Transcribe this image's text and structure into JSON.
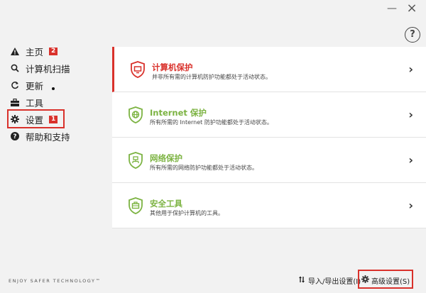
{
  "window": {
    "minimize_glyph": "—",
    "close_glyph": "×",
    "help_glyph": "?"
  },
  "sidebar": {
    "items": [
      {
        "label": "主页",
        "icon": "warning-icon",
        "badge": "2"
      },
      {
        "label": "计算机扫描",
        "icon": "search-icon"
      },
      {
        "label": "更新",
        "icon": "refresh-icon"
      },
      {
        "label": "工具",
        "icon": "toolbox-icon"
      },
      {
        "label": "设置",
        "icon": "gear-icon",
        "badge": "1",
        "highlighted": true
      },
      {
        "label": "帮助和支持",
        "icon": "help-icon"
      }
    ],
    "brand": "ENJOY SAFER TECHNOLOGY™"
  },
  "main": {
    "rows": [
      {
        "title": "计算机保护",
        "desc": "并非所有需的计算机防护功能都处于活动状态。",
        "status": "warning",
        "icon": "shield-monitor-icon"
      },
      {
        "title": "Internet 保护",
        "desc": "所有所需的 Internet 防护功能都处于活动状态。",
        "status": "ok",
        "icon": "shield-globe-icon"
      },
      {
        "title": "网络保护",
        "desc": "所有所需的网络防护功能都处于活动状态。",
        "status": "ok",
        "icon": "shield-network-icon"
      },
      {
        "title": "安全工具",
        "desc": "其他用于保护计算机的工具。",
        "status": "ok",
        "icon": "shield-briefcase-icon"
      }
    ],
    "chevron": "›"
  },
  "footer": {
    "import_export": "导入/导出设置(I)",
    "advanced": "高级设置(S)"
  },
  "colors": {
    "accent_red": "#d9312b",
    "ok_green": "#7cb342"
  }
}
